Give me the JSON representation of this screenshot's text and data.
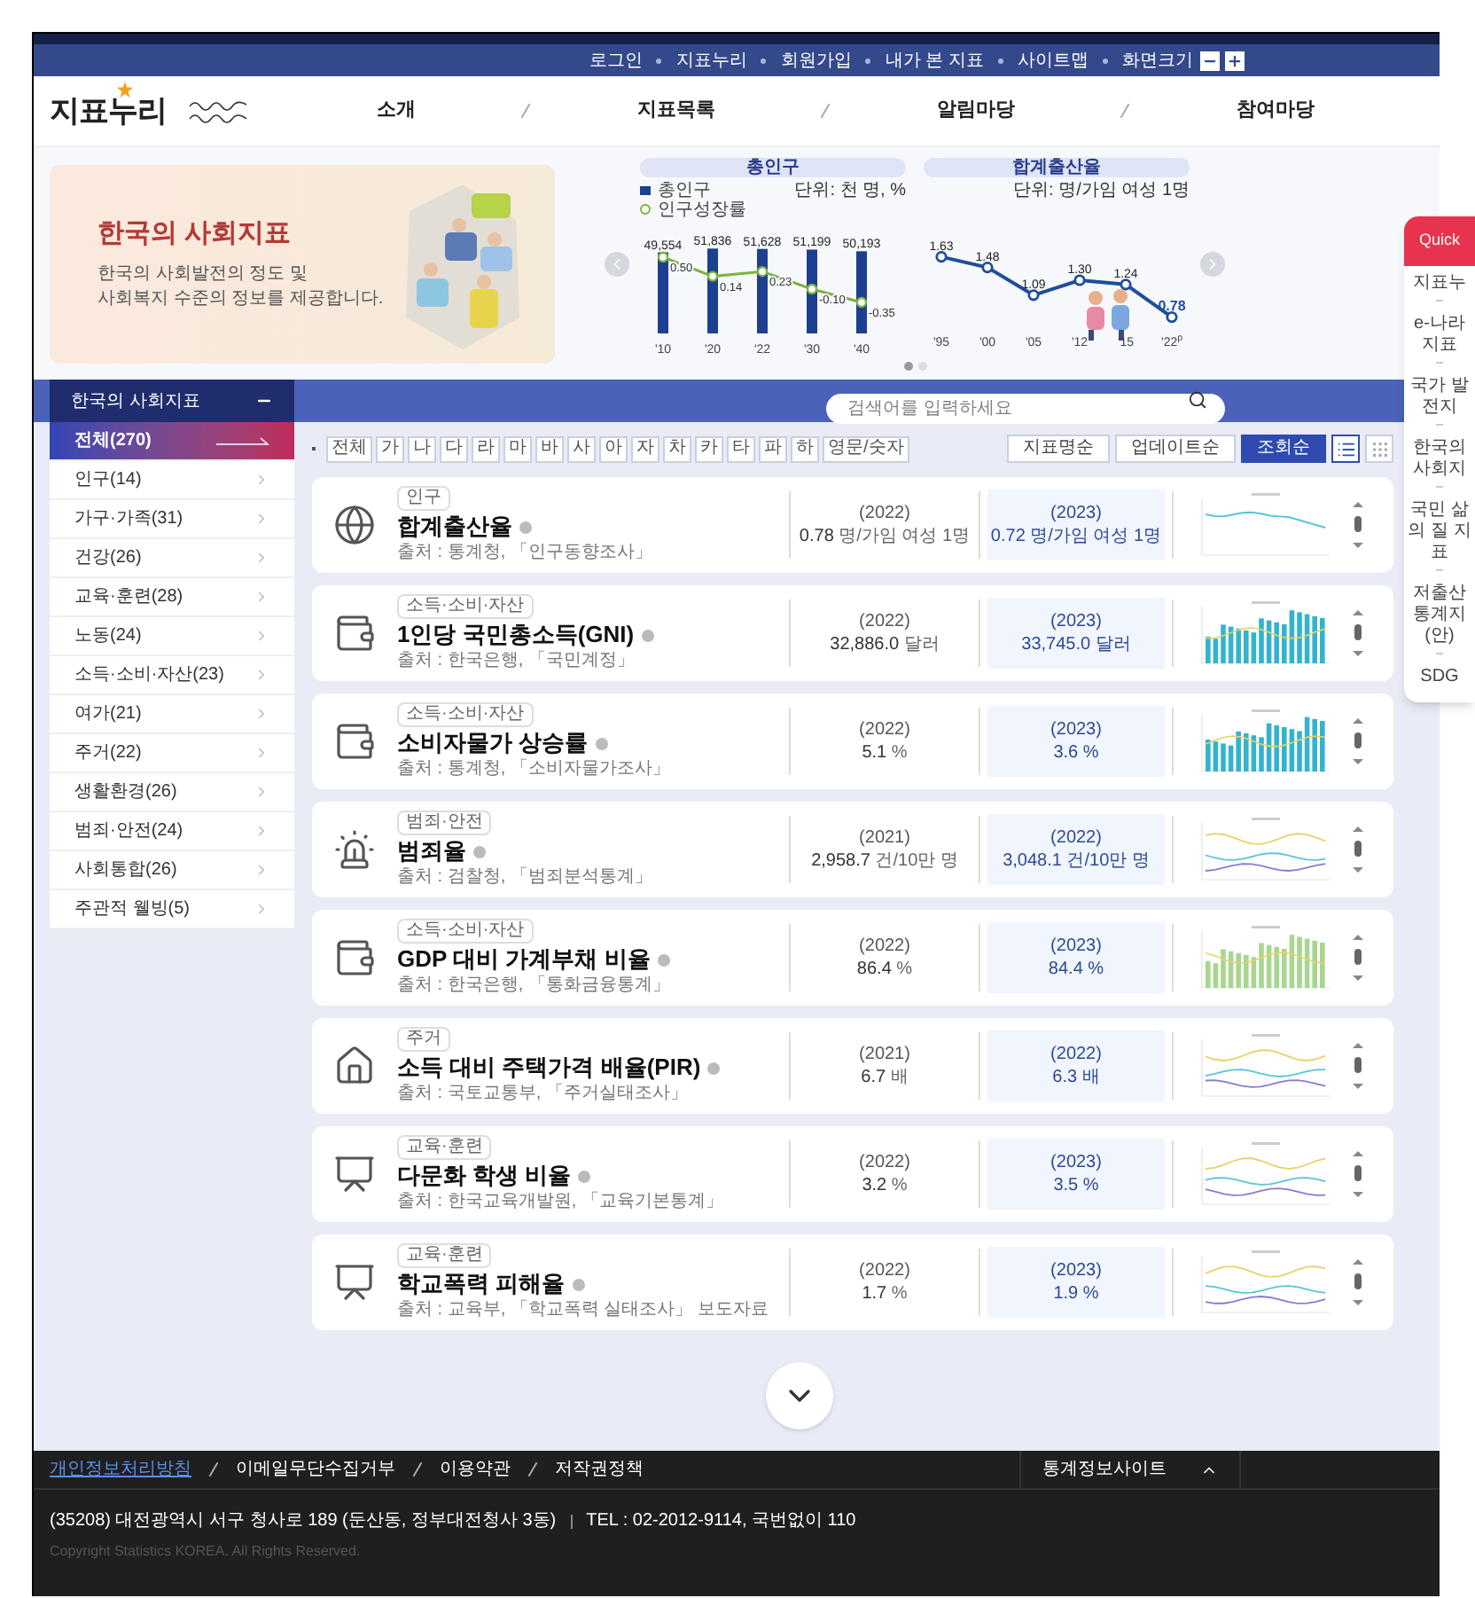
{
  "top_bar": {
    "links": [
      "로그인",
      "지표누리",
      "회원가입",
      "내가 본 지표",
      "사이트맵",
      "화면크기"
    ]
  },
  "header": {
    "logo": "지표누리",
    "nav": [
      "소개",
      "지표목록",
      "알림마당",
      "참여마당"
    ]
  },
  "banner": {
    "title": "한국의 사회지표",
    "description": [
      "한국의 사회발전의 정도 및",
      "사회복지 수준의 정보를 제공합니다."
    ],
    "charts": [
      {
        "unit": "단위: 천 명, %",
        "layers": [
          {
            "chart_data": {
              "type": "bar",
              "title": "총인구",
              "categories": [
                "'10",
                "'20",
                "'22",
                "'30",
                "'40"
              ],
              "series": [
                {
                  "name": "총인구",
                  "color": "#1d3f8f",
                  "values": [
                    49554,
                    51836,
                    51628,
                    51199,
                    50193
                  ],
                  "value_labels": [
                    "49,554",
                    "51,836",
                    "51,628",
                    "51,199",
                    "50,193"
                  ]
                }
              ]
            }
          },
          {
            "chart_data": {
              "type": "line",
              "series": [
                {
                  "name": "인구성장률",
                  "marker": true,
                  "color": "#7cb342",
                  "values": [
                    0.5,
                    0.14,
                    0.23,
                    -0.1,
                    -0.35
                  ],
                  "value_labels": [
                    "0.50",
                    "0.14",
                    "0.23",
                    "-0.10",
                    "-0.35"
                  ]
                }
              ]
            }
          }
        ]
      },
      {
        "unit": "단위: 명/가임 여성 1명",
        "chart_data": {
          "type": "line",
          "title": "합계출산율",
          "categories": [
            "'95",
            "'00",
            "'05",
            "'12",
            "'15",
            "'22$^{p}$"
          ],
          "series": [
            {
              "color": "#1d4f9a",
              "marker": true,
              "values": [
                1.63,
                1.48,
                1.09,
                1.3,
                1.24,
                0.78
              ],
              "value_labels": [
                "1.63",
                "1.48",
                "1.09",
                "1.30",
                "1.24",
                "0.78"
              ]
            }
          ]
        }
      }
    ],
    "pages": [
      {
        "selected": true
      },
      {
        "selected": false
      }
    ]
  },
  "sidebar": {
    "title": "한국의 사회지표",
    "items": [
      {
        "label": "전체(270)",
        "selected": true
      },
      {
        "label": "인구(14)",
        "selected": false
      },
      {
        "label": "가구·가족(31)",
        "selected": false
      },
      {
        "label": "건강(26)",
        "selected": false
      },
      {
        "label": "교육·훈련(28)",
        "selected": false
      },
      {
        "label": "노동(24)",
        "selected": false
      },
      {
        "label": "소득·소비·자산(23)",
        "selected": false
      },
      {
        "label": "여가(21)",
        "selected": false
      },
      {
        "label": "주거(22)",
        "selected": false
      },
      {
        "label": "생활환경(26)",
        "selected": false
      },
      {
        "label": "범죄·안전(24)",
        "selected": false
      },
      {
        "label": "사회통합(26)",
        "selected": false
      },
      {
        "label": "주관적 웰빙(5)",
        "selected": false
      }
    ]
  },
  "search": {
    "placeholder": "검색어를 입력하세요"
  },
  "letters": [
    {
      "label": "전체",
      "selected": false
    },
    {
      "label": "가",
      "selected": false
    },
    {
      "label": "나",
      "selected": false
    },
    {
      "label": "다",
      "selected": false
    },
    {
      "label": "라",
      "selected": false
    },
    {
      "label": "마",
      "selected": false
    },
    {
      "label": "바",
      "selected": false
    },
    {
      "label": "사",
      "selected": false
    },
    {
      "label": "아",
      "selected": false
    },
    {
      "label": "자",
      "selected": false
    },
    {
      "label": "차",
      "selected": false
    },
    {
      "label": "카",
      "selected": false
    },
    {
      "label": "타",
      "selected": false
    },
    {
      "label": "파",
      "selected": false
    },
    {
      "label": "하",
      "selected": false
    },
    {
      "label": "영문/숫자",
      "selected": false
    }
  ],
  "sort": [
    {
      "label": "지표명순",
      "selected": false
    },
    {
      "label": "업데이트순",
      "selected": false
    },
    {
      "label": "조회순",
      "selected": true
    }
  ],
  "views": [
    {
      "kind": "list",
      "selected": true
    },
    {
      "kind": "grid",
      "selected": false
    }
  ],
  "cards": [
    {
      "tag": "인구",
      "title": "합계출산율",
      "source": "출처 : 통계청, 「인구동향조사」",
      "prev": {
        "year": "(2022)",
        "value": "0.78",
        "unit": "명/가임 여성 1명"
      },
      "curr": {
        "year": "(2023)",
        "value": "0.72",
        "unit": "명/가임 여성 1명"
      },
      "kind": "line"
    },
    {
      "tag": "소득·소비·자산",
      "title": "1인당 국민총소득(GNI)",
      "source": "출처 : 한국은행, 「국민계정」",
      "prev": {
        "year": "(2022)",
        "value": "32,886.0",
        "unit": "달러"
      },
      "curr": {
        "year": "(2023)",
        "value": "33,745.0",
        "unit": "달러"
      },
      "kind": "bar"
    },
    {
      "tag": "소득·소비·자산",
      "title": "소비자물가 상승률",
      "source": "출처 : 통계청, 「소비자물가조사」",
      "prev": {
        "year": "(2022)",
        "value": "5.1",
        "unit": "%"
      },
      "curr": {
        "year": "(2023)",
        "value": "3.6",
        "unit": "%"
      },
      "kind": "bar"
    },
    {
      "tag": "범죄·안전",
      "title": "범죄율",
      "source": "출처 : 검찰청, 「범죄분석통계」",
      "prev": {
        "year": "(2021)",
        "value": "2,958.7",
        "unit": "건/10만 명"
      },
      "curr": {
        "year": "(2022)",
        "value": "3,048.1",
        "unit": "건/10만 명"
      },
      "kind": "multiline"
    },
    {
      "tag": "소득·소비·자산",
      "title": "GDP 대비 가계부채 비율",
      "source": "출처 : 한국은행, 「통화금융통계」",
      "prev": {
        "year": "(2022)",
        "value": "86.4",
        "unit": "%"
      },
      "curr": {
        "year": "(2023)",
        "value": "84.4",
        "unit": "%"
      },
      "kind": "bar"
    },
    {
      "tag": "주거",
      "title": "소득 대비 주택가격 배율(PIR)",
      "source": "출처 : 국토교통부, 「주거실태조사」",
      "prev": {
        "year": "(2021)",
        "value": "6.7",
        "unit": "배"
      },
      "curr": {
        "year": "(2022)",
        "value": "6.3",
        "unit": "배"
      },
      "kind": "multiline"
    },
    {
      "tag": "교육·훈련",
      "title": "다문화 학생 비율",
      "source": "출처 : 한국교육개발원, 「교육기본통계」",
      "prev": {
        "year": "(2022)",
        "value": "3.2",
        "unit": "%"
      },
      "curr": {
        "year": "(2023)",
        "value": "3.5",
        "unit": "%"
      },
      "kind": "multiline"
    },
    {
      "tag": "교육·훈련",
      "title": "학교폭력 피해율",
      "source": "출처 : 교육부, 「학교폭력 실태조사」 보도자료",
      "prev": {
        "year": "(2022)",
        "value": "1.7",
        "unit": "%"
      },
      "curr": {
        "year": "(2023)",
        "value": "1.9",
        "unit": "%"
      },
      "kind": "multiline"
    }
  ],
  "quick_menu": {
    "title": "Quick",
    "items": [
      "지표누",
      "e-나라 지표",
      "국가 발전지",
      "한국의 사회지",
      "국민 삶의 질 지표",
      "저출산 통계지 (안)",
      "SDG"
    ]
  },
  "footer": {
    "links": [
      {
        "label": "개인정보처리방침",
        "highlighted": true
      },
      {
        "label": "이메일무단수집거부",
        "highlighted": false
      },
      {
        "label": "이용약관",
        "highlighted": false
      },
      {
        "label": "저작권정책",
        "highlighted": false
      }
    ],
    "family_site": "통계정보사이트",
    "address": "(35208) 대전광역시 서구 청사로 189 (둔산동, 정부대전청사 3동)",
    "tel": "TEL : 02-2012-9114, 국번없이 110",
    "copyright": "Copyright Statistics KOREA. All Rights Reserved."
  }
}
